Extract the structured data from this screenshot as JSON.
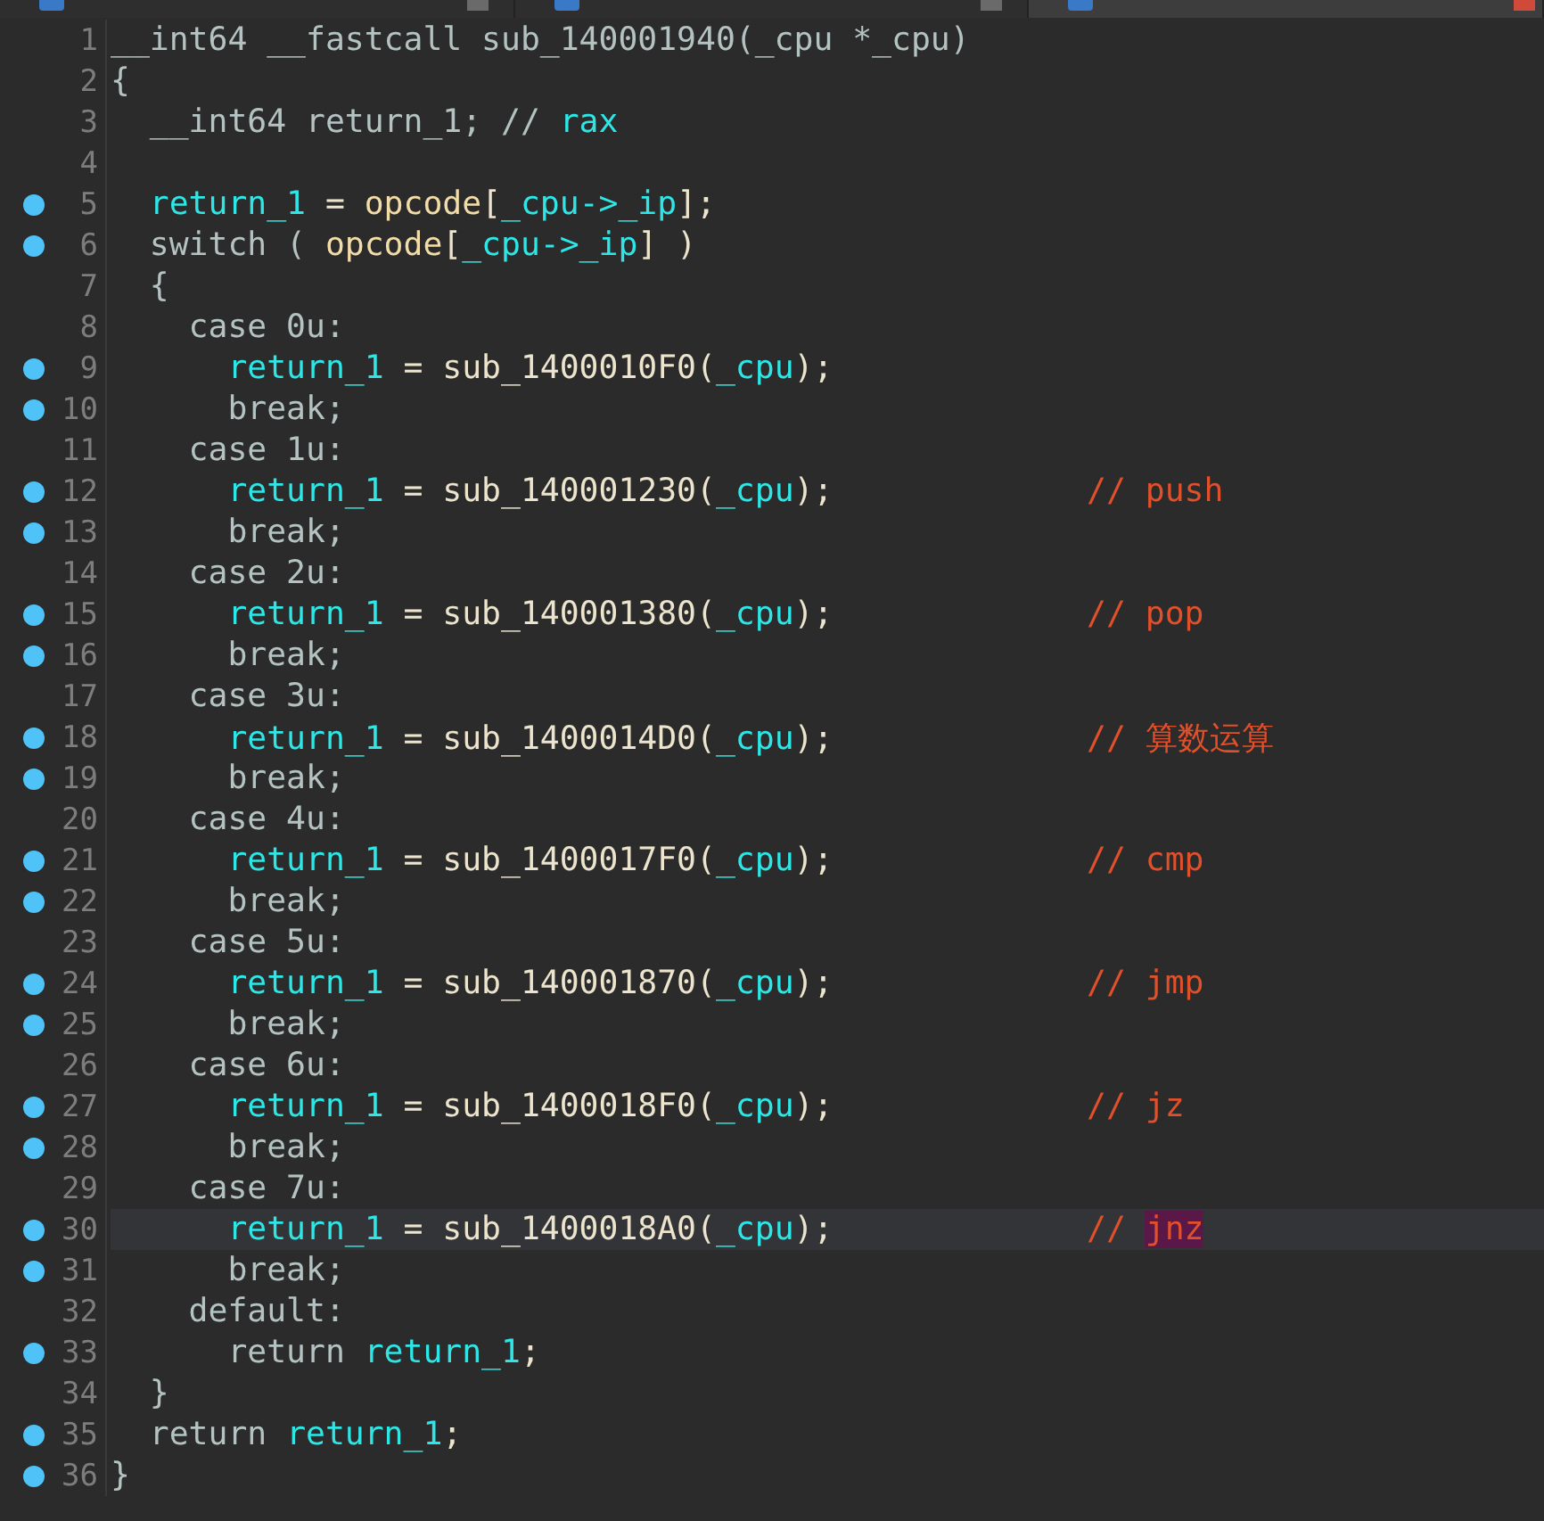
{
  "tabs": [
    {
      "selected": false
    },
    {
      "selected": false
    },
    {
      "selected": true
    }
  ],
  "lines": [
    {
      "number": "1",
      "breakpoint": false,
      "current": false,
      "tokens": [
        {
          "kind": "keyword",
          "text": "__int64 __fastcall sub_140001940(_cpu *_cpu)"
        }
      ]
    },
    {
      "number": "2",
      "breakpoint": false,
      "current": false,
      "tokens": [
        {
          "kind": "keyword",
          "text": "{"
        }
      ]
    },
    {
      "number": "3",
      "breakpoint": false,
      "current": false,
      "tokens": [
        {
          "kind": "keyword",
          "text": "  __int64 return_1; // "
        },
        {
          "kind": "local",
          "text": "rax"
        }
      ]
    },
    {
      "number": "4",
      "breakpoint": false,
      "current": false
    },
    {
      "number": "5",
      "breakpoint": true,
      "current": false,
      "tokens": [
        {
          "kind": "local",
          "text": "  return_1"
        },
        {
          "kind": "text",
          "text": " = "
        },
        {
          "kind": "global",
          "text": "opcode"
        },
        {
          "kind": "text",
          "text": "["
        },
        {
          "kind": "local",
          "text": "_cpu->_ip"
        },
        {
          "kind": "text",
          "text": "];"
        }
      ]
    },
    {
      "number": "6",
      "breakpoint": true,
      "current": false,
      "tokens": [
        {
          "kind": "keyword",
          "text": "  switch ( "
        },
        {
          "kind": "global",
          "text": "opcode"
        },
        {
          "kind": "text",
          "text": "["
        },
        {
          "kind": "local",
          "text": "_cpu->_ip"
        },
        {
          "kind": "text",
          "text": "] )"
        }
      ]
    },
    {
      "number": "7",
      "breakpoint": false,
      "current": false,
      "tokens": [
        {
          "kind": "keyword",
          "text": "  {"
        }
      ]
    },
    {
      "number": "8",
      "breakpoint": false,
      "current": false,
      "tokens": [
        {
          "kind": "keyword",
          "text": "    case 0u:"
        }
      ]
    },
    {
      "number": "9",
      "breakpoint": true,
      "current": false,
      "tokens": [
        {
          "kind": "local",
          "text": "      return_1"
        },
        {
          "kind": "text",
          "text": " = sub_1400010F0("
        },
        {
          "kind": "local",
          "text": "_cpu"
        },
        {
          "kind": "text",
          "text": ");"
        }
      ]
    },
    {
      "number": "10",
      "breakpoint": true,
      "current": false,
      "tokens": [
        {
          "kind": "keyword",
          "text": "      break;"
        }
      ]
    },
    {
      "number": "11",
      "breakpoint": false,
      "current": false,
      "tokens": [
        {
          "kind": "keyword",
          "text": "    case 1u:"
        }
      ]
    },
    {
      "number": "12",
      "breakpoint": true,
      "current": false,
      "tokens": [
        {
          "kind": "local",
          "text": "      return_1"
        },
        {
          "kind": "text",
          "text": " = sub_140001230("
        },
        {
          "kind": "local",
          "text": "_cpu"
        },
        {
          "kind": "text",
          "text": ");             "
        },
        {
          "kind": "comment",
          "text": "// push"
        }
      ]
    },
    {
      "number": "13",
      "breakpoint": true,
      "current": false,
      "tokens": [
        {
          "kind": "keyword",
          "text": "      break;"
        }
      ]
    },
    {
      "number": "14",
      "breakpoint": false,
      "current": false,
      "tokens": [
        {
          "kind": "keyword",
          "text": "    case 2u:"
        }
      ]
    },
    {
      "number": "15",
      "breakpoint": true,
      "current": false,
      "tokens": [
        {
          "kind": "local",
          "text": "      return_1"
        },
        {
          "kind": "text",
          "text": " = sub_140001380("
        },
        {
          "kind": "local",
          "text": "_cpu"
        },
        {
          "kind": "text",
          "text": ");             "
        },
        {
          "kind": "comment",
          "text": "// pop"
        }
      ]
    },
    {
      "number": "16",
      "breakpoint": true,
      "current": false,
      "tokens": [
        {
          "kind": "keyword",
          "text": "      break;"
        }
      ]
    },
    {
      "number": "17",
      "breakpoint": false,
      "current": false,
      "tokens": [
        {
          "kind": "keyword",
          "text": "    case 3u:"
        }
      ]
    },
    {
      "number": "18",
      "breakpoint": true,
      "current": false,
      "tokens": [
        {
          "kind": "local",
          "text": "      return_1"
        },
        {
          "kind": "text",
          "text": " = sub_1400014D0("
        },
        {
          "kind": "local",
          "text": "_cpu"
        },
        {
          "kind": "text",
          "text": ");             "
        },
        {
          "kind": "comment",
          "text": "// 算数运算"
        }
      ]
    },
    {
      "number": "19",
      "breakpoint": true,
      "current": false,
      "tokens": [
        {
          "kind": "keyword",
          "text": "      break;"
        }
      ]
    },
    {
      "number": "20",
      "breakpoint": false,
      "current": false,
      "tokens": [
        {
          "kind": "keyword",
          "text": "    case 4u:"
        }
      ]
    },
    {
      "number": "21",
      "breakpoint": true,
      "current": false,
      "tokens": [
        {
          "kind": "local",
          "text": "      return_1"
        },
        {
          "kind": "text",
          "text": " = sub_1400017F0("
        },
        {
          "kind": "local",
          "text": "_cpu"
        },
        {
          "kind": "text",
          "text": ");             "
        },
        {
          "kind": "comment",
          "text": "// cmp"
        }
      ]
    },
    {
      "number": "22",
      "breakpoint": true,
      "current": false,
      "tokens": [
        {
          "kind": "keyword",
          "text": "      break;"
        }
      ]
    },
    {
      "number": "23",
      "breakpoint": false,
      "current": false,
      "tokens": [
        {
          "kind": "keyword",
          "text": "    case 5u:"
        }
      ]
    },
    {
      "number": "24",
      "breakpoint": true,
      "current": false,
      "tokens": [
        {
          "kind": "local",
          "text": "      return_1"
        },
        {
          "kind": "text",
          "text": " = sub_140001870("
        },
        {
          "kind": "local",
          "text": "_cpu"
        },
        {
          "kind": "text",
          "text": ");             "
        },
        {
          "kind": "comment",
          "text": "// jmp"
        }
      ]
    },
    {
      "number": "25",
      "breakpoint": true,
      "current": false,
      "tokens": [
        {
          "kind": "keyword",
          "text": "      break;"
        }
      ]
    },
    {
      "number": "26",
      "breakpoint": false,
      "current": false,
      "tokens": [
        {
          "kind": "keyword",
          "text": "    case 6u:"
        }
      ]
    },
    {
      "number": "27",
      "breakpoint": true,
      "current": false,
      "tokens": [
        {
          "kind": "local",
          "text": "      return_1"
        },
        {
          "kind": "text",
          "text": " = sub_1400018F0("
        },
        {
          "kind": "local",
          "text": "_cpu"
        },
        {
          "kind": "text",
          "text": ");             "
        },
        {
          "kind": "comment",
          "text": "// jz"
        }
      ]
    },
    {
      "number": "28",
      "breakpoint": true,
      "current": false,
      "tokens": [
        {
          "kind": "keyword",
          "text": "      break;"
        }
      ]
    },
    {
      "number": "29",
      "breakpoint": false,
      "current": false,
      "tokens": [
        {
          "kind": "keyword",
          "text": "    case 7u:"
        }
      ]
    },
    {
      "number": "30",
      "breakpoint": true,
      "current": true,
      "tokens": [
        {
          "kind": "local",
          "text": "      return_1"
        },
        {
          "kind": "text",
          "text": " = sub_1400018A0("
        },
        {
          "kind": "local",
          "text": "_cpu"
        },
        {
          "kind": "text",
          "text": ");             "
        },
        {
          "kind": "comment",
          "text": "// "
        },
        {
          "kind": "comment",
          "text": "jnz",
          "highlighted": true
        }
      ]
    },
    {
      "number": "31",
      "breakpoint": true,
      "current": false,
      "tokens": [
        {
          "kind": "keyword",
          "text": "      break;"
        }
      ]
    },
    {
      "number": "32",
      "breakpoint": false,
      "current": false,
      "tokens": [
        {
          "kind": "keyword",
          "text": "    default:"
        }
      ]
    },
    {
      "number": "33",
      "breakpoint": true,
      "current": false,
      "tokens": [
        {
          "kind": "keyword",
          "text": "      return "
        },
        {
          "kind": "local",
          "text": "return_1"
        },
        {
          "kind": "text",
          "text": ";"
        }
      ]
    },
    {
      "number": "34",
      "breakpoint": false,
      "current": false,
      "tokens": [
        {
          "kind": "keyword",
          "text": "  }"
        }
      ]
    },
    {
      "number": "35",
      "breakpoint": true,
      "current": false,
      "tokens": [
        {
          "kind": "keyword",
          "text": "  return "
        },
        {
          "kind": "local",
          "text": "return_1"
        },
        {
          "kind": "text",
          "text": ";"
        }
      ]
    },
    {
      "number": "36",
      "breakpoint": true,
      "current": false,
      "tokens": [
        {
          "kind": "keyword",
          "text": "}"
        }
      ]
    }
  ]
}
